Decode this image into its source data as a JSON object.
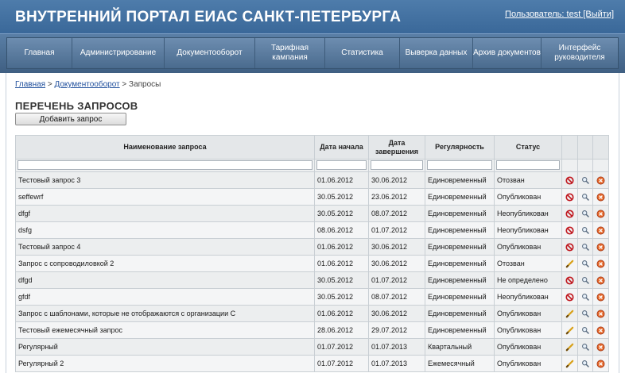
{
  "header": {
    "title": "ВНУТРЕННИЙ ПОРТАЛ ЕИАС САНКТ-ПЕТЕРБУРГА",
    "user_label": "Пользователь: test [Выйти]"
  },
  "nav": {
    "items": [
      {
        "label": "Главная"
      },
      {
        "label": "Администрирование"
      },
      {
        "label": "Документооборот"
      },
      {
        "label": "Тарифная кампания"
      },
      {
        "label": "Статистика"
      },
      {
        "label": "Выверка данных"
      },
      {
        "label": "Архив документов"
      },
      {
        "label": "Интерфейс руководителя"
      }
    ]
  },
  "breadcrumb": {
    "home": "Главная",
    "separator": ">",
    "section": "Документооборот",
    "current": "Запросы"
  },
  "page": {
    "title": "ПЕРЕЧЕНЬ ЗАПРОСОВ",
    "add_button": "Добавить запрос"
  },
  "table": {
    "headers": {
      "name": "Наименование запроса",
      "start": "Дата начала",
      "end": "Дата завершения",
      "regularity": "Регулярность",
      "status": "Статус"
    },
    "rows": [
      {
        "name": "Тестовый запрос 3",
        "start": "01.06.2012",
        "end": "30.06.2012",
        "regularity": "Единовременный",
        "status": "Отозван",
        "action": "ban"
      },
      {
        "name": "seffewrf",
        "start": "30.05.2012",
        "end": "23.06.2012",
        "regularity": "Единовременный",
        "status": "Опубликован",
        "action": "ban"
      },
      {
        "name": "dfgf",
        "start": "30.05.2012",
        "end": "08.07.2012",
        "regularity": "Единовременный",
        "status": "Неопубликован",
        "action": "ban"
      },
      {
        "name": "dsfg",
        "start": "08.06.2012",
        "end": "01.07.2012",
        "regularity": "Единовременный",
        "status": "Неопубликован",
        "action": "ban"
      },
      {
        "name": "Тестовый запрос 4",
        "start": "01.06.2012",
        "end": "30.06.2012",
        "regularity": "Единовременный",
        "status": "Опубликован",
        "action": "ban"
      },
      {
        "name": "Запрос с сопроводиловкой 2",
        "start": "01.06.2012",
        "end": "30.06.2012",
        "regularity": "Единовременный",
        "status": "Отозван",
        "action": "edit"
      },
      {
        "name": "dfgd",
        "start": "30.05.2012",
        "end": "01.07.2012",
        "regularity": "Единовременный",
        "status": "Не определено",
        "action": "ban"
      },
      {
        "name": "gfdf",
        "start": "30.05.2012",
        "end": "08.07.2012",
        "regularity": "Единовременный",
        "status": "Неопубликован",
        "action": "ban"
      },
      {
        "name": "Запрос с шаблонами, которые не отображаются с организации С",
        "start": "01.06.2012",
        "end": "30.06.2012",
        "regularity": "Единовременный",
        "status": "Опубликован",
        "action": "edit"
      },
      {
        "name": "Тестовый ежемесячный запрос",
        "start": "28.06.2012",
        "end": "29.07.2012",
        "regularity": "Единовременный",
        "status": "Опубликован",
        "action": "edit"
      },
      {
        "name": "Регулярный",
        "start": "01.07.2012",
        "end": "01.07.2013",
        "regularity": "Квартальный",
        "status": "Опубликован",
        "action": "edit"
      },
      {
        "name": "Регулярный 2",
        "start": "01.07.2012",
        "end": "01.07.2013",
        "regularity": "Ежемесячный",
        "status": "Опубликован",
        "action": "edit"
      }
    ]
  },
  "icons": {
    "ban": "ban-icon",
    "edit": "pencil-icon",
    "view": "magnifier-icon",
    "delete": "delete-icon"
  },
  "colors": {
    "header_bg": "#4a78a8",
    "nav_bg": "#5a7fa6",
    "ban_red": "#c0181f",
    "pencil": "#d9a21b"
  }
}
